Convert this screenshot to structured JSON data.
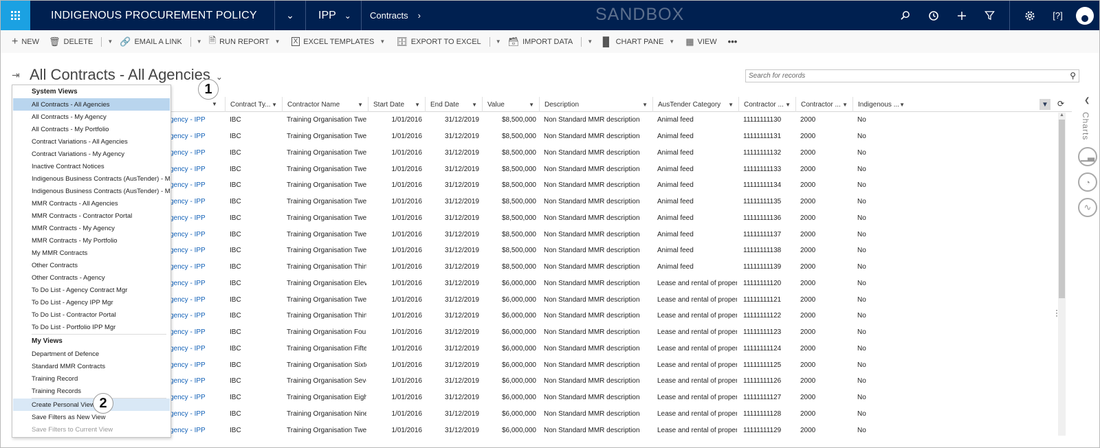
{
  "nav": {
    "app_title": "INDIGENOUS PROCUREMENT POLICY",
    "module": "IPP",
    "entity": "Contracts",
    "environment": "SANDBOX",
    "colors": {
      "nav_bg": "#002050",
      "waffle_bg": "#1ba1e2"
    }
  },
  "toolbar": {
    "new": "NEW",
    "delete": "DELETE",
    "email_link": "EMAIL A LINK",
    "run_report": "RUN REPORT",
    "excel_templates": "EXCEL TEMPLATES",
    "export_excel": "EXPORT TO EXCEL",
    "import_data": "IMPORT DATA",
    "chart_pane": "CHART PANE",
    "view": "VIEW",
    "more": "•••"
  },
  "view": {
    "title": "All Contracts - All Agencies",
    "search_placeholder": "Search for records"
  },
  "grid": {
    "columns": [
      "Contract Ty...",
      "Contractor Name",
      "Start Date",
      "End Date",
      "Value",
      "Description",
      "AusTender Category",
      "Contractor ...",
      "Contractor ...",
      "Indigenous ..."
    ],
    "rows": [
      [
        "gency - IPP",
        "IBC",
        "Training Organisation Twe...",
        "1/01/2016",
        "31/12/2019",
        "$8,500,000",
        "Non Standard MMR description",
        "Animal feed",
        "11111111130",
        "2000",
        "No"
      ],
      [
        "gency - IPP",
        "IBC",
        "Training Organisation Twe...",
        "1/01/2016",
        "31/12/2019",
        "$8,500,000",
        "Non Standard MMR description",
        "Animal feed",
        "11111111131",
        "2000",
        "No"
      ],
      [
        "gency - IPP",
        "IBC",
        "Training Organisation Twe...",
        "1/01/2016",
        "31/12/2019",
        "$8,500,000",
        "Non Standard MMR description",
        "Animal feed",
        "11111111132",
        "2000",
        "No"
      ],
      [
        "gency - IPP",
        "IBC",
        "Training Organisation Twe...",
        "1/01/2016",
        "31/12/2019",
        "$8,500,000",
        "Non Standard MMR description",
        "Animal feed",
        "11111111133",
        "2000",
        "No"
      ],
      [
        "gency - IPP",
        "IBC",
        "Training Organisation Twe...",
        "1/01/2016",
        "31/12/2019",
        "$8,500,000",
        "Non Standard MMR description",
        "Animal feed",
        "11111111134",
        "2000",
        "No"
      ],
      [
        "gency - IPP",
        "IBC",
        "Training Organisation Twe...",
        "1/01/2016",
        "31/12/2019",
        "$8,500,000",
        "Non Standard MMR description",
        "Animal feed",
        "11111111135",
        "2000",
        "No"
      ],
      [
        "gency - IPP",
        "IBC",
        "Training Organisation Twe...",
        "1/01/2016",
        "31/12/2019",
        "$8,500,000",
        "Non Standard MMR description",
        "Animal feed",
        "11111111136",
        "2000",
        "No"
      ],
      [
        "gency - IPP",
        "IBC",
        "Training Organisation Twe...",
        "1/01/2016",
        "31/12/2019",
        "$8,500,000",
        "Non Standard MMR description",
        "Animal feed",
        "11111111137",
        "2000",
        "No"
      ],
      [
        "gency - IPP",
        "IBC",
        "Training Organisation Twe...",
        "1/01/2016",
        "31/12/2019",
        "$8,500,000",
        "Non Standard MMR description",
        "Animal feed",
        "11111111138",
        "2000",
        "No"
      ],
      [
        "gency - IPP",
        "IBC",
        "Training Organisation Thirty",
        "1/01/2016",
        "31/12/2019",
        "$8,500,000",
        "Non Standard MMR description",
        "Animal feed",
        "11111111139",
        "2000",
        "No"
      ],
      [
        "gency - IPP",
        "IBC",
        "Training Organisation Eleven",
        "1/01/2016",
        "31/12/2019",
        "$6,000,000",
        "Non Standard MMR description",
        "Lease and rental of proper...",
        "11111111120",
        "2000",
        "No"
      ],
      [
        "gency - IPP",
        "IBC",
        "Training Organisation Twel...",
        "1/01/2016",
        "31/12/2019",
        "$6,000,000",
        "Non Standard MMR description",
        "Lease and rental of proper...",
        "11111111121",
        "2000",
        "No"
      ],
      [
        "gency - IPP",
        "IBC",
        "Training Organisation Thirt...",
        "1/01/2016",
        "31/12/2019",
        "$6,000,000",
        "Non Standard MMR description",
        "Lease and rental of proper...",
        "11111111122",
        "2000",
        "No"
      ],
      [
        "gency - IPP",
        "IBC",
        "Training Organisation Four...",
        "1/01/2016",
        "31/12/2019",
        "$6,000,000",
        "Non Standard MMR description",
        "Lease and rental of proper...",
        "11111111123",
        "2000",
        "No"
      ],
      [
        "gency - IPP",
        "IBC",
        "Training Organisation Fifte...",
        "1/01/2016",
        "31/12/2019",
        "$6,000,000",
        "Non Standard MMR description",
        "Lease and rental of proper...",
        "11111111124",
        "2000",
        "No"
      ],
      [
        "gency - IPP",
        "IBC",
        "Training Organisation Sixte...",
        "1/01/2016",
        "31/12/2019",
        "$6,000,000",
        "Non Standard MMR description",
        "Lease and rental of proper...",
        "11111111125",
        "2000",
        "No"
      ],
      [
        "gency - IPP",
        "IBC",
        "Training Organisation Seve...",
        "1/01/2016",
        "31/12/2019",
        "$6,000,000",
        "Non Standard MMR description",
        "Lease and rental of proper...",
        "11111111126",
        "2000",
        "No"
      ],
      [
        "gency - IPP",
        "IBC",
        "Training Organisation Eigh...",
        "1/01/2016",
        "31/12/2019",
        "$6,000,000",
        "Non Standard MMR description",
        "Lease and rental of proper...",
        "11111111127",
        "2000",
        "No"
      ],
      [
        "gency - IPP",
        "IBC",
        "Training Organisation Nine...",
        "1/01/2016",
        "31/12/2019",
        "$6,000,000",
        "Non Standard MMR description",
        "Lease and rental of proper...",
        "11111111128",
        "2000",
        "No"
      ],
      [
        "gency - IPP",
        "IBC",
        "Training Organisation Twe...",
        "1/01/2016",
        "31/12/2019",
        "$6,000,000",
        "Non Standard MMR description",
        "Lease and rental of proper...",
        "11111111129",
        "2000",
        "No"
      ]
    ]
  },
  "dropdown": {
    "system_views_label": "System Views",
    "system_views": [
      "All Contracts - All Agencies",
      "All Contracts - My Agency",
      "All Contracts - My Portfolio",
      "Contract Variations - All Agencies",
      "Contract Variations - My Agency",
      "Inactive Contract Notices",
      "Indigenous Business Contracts (AusTender) - My ...",
      "Indigenous Business Contracts (AusTender) - My ...",
      "MMR Contracts - All Agencies",
      "MMR Contracts - Contractor Portal",
      "MMR Contracts - My Agency",
      "MMR Contracts - My Portfolio",
      "My MMR Contracts",
      "Other Contracts",
      "Other Contracts - Agency",
      "To Do List - Agency Contract Mgr",
      "To Do List - Agency IPP Mgr",
      "To Do List - Contractor Portal",
      "To Do List - Portfolio IPP Mgr"
    ],
    "my_views_label": "My Views",
    "my_views": [
      "Department of Defence",
      "Standard MMR Contracts",
      "Training Record",
      "Training Records"
    ],
    "actions": [
      "Create Personal View",
      "Save Filters as New View",
      "Save Filters to Current View"
    ]
  },
  "charts_pane": {
    "label": "Charts"
  },
  "callouts": [
    "1",
    "2"
  ]
}
